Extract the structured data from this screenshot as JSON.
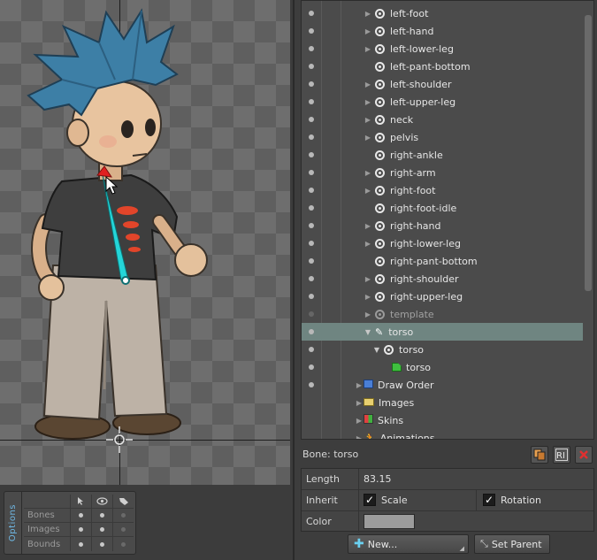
{
  "options": {
    "tab_label": "Options",
    "rows": [
      {
        "label": "Bones",
        "dots": [
          true,
          true,
          false
        ]
      },
      {
        "label": "Images",
        "dots": [
          true,
          true,
          false
        ]
      },
      {
        "label": "Bounds",
        "dots": [
          true,
          true,
          false
        ]
      }
    ],
    "column_icons": [
      "cursor-icon",
      "eye-icon",
      "tag-icon"
    ]
  },
  "tree": {
    "bones": [
      {
        "label": "left-foot",
        "arrow": true
      },
      {
        "label": "left-hand",
        "arrow": true
      },
      {
        "label": "left-lower-leg",
        "arrow": true
      },
      {
        "label": "left-pant-bottom",
        "arrow": false
      },
      {
        "label": "left-shoulder",
        "arrow": true
      },
      {
        "label": "left-upper-leg",
        "arrow": true
      },
      {
        "label": "neck",
        "arrow": true
      },
      {
        "label": "pelvis",
        "arrow": true
      },
      {
        "label": "right-ankle",
        "arrow": false
      },
      {
        "label": "right-arm",
        "arrow": true
      },
      {
        "label": "right-foot",
        "arrow": true
      },
      {
        "label": "right-foot-idle",
        "arrow": false
      },
      {
        "label": "right-hand",
        "arrow": true
      },
      {
        "label": "right-lower-leg",
        "arrow": true
      },
      {
        "label": "right-pant-bottom",
        "arrow": false
      },
      {
        "label": "right-shoulder",
        "arrow": true
      },
      {
        "label": "right-upper-leg",
        "arrow": true
      },
      {
        "label": "template",
        "arrow": true
      }
    ],
    "selected": "torso",
    "torso_slot": "torso",
    "torso_attachment": "torso",
    "sections": [
      {
        "label": "Draw Order",
        "icon": "draw-order-icon"
      },
      {
        "label": "Images",
        "icon": "folder-icon"
      },
      {
        "label": "Skins",
        "icon": "skins-icon"
      },
      {
        "label": "Animations",
        "icon": "animations-icon"
      }
    ]
  },
  "bone_panel": {
    "title": "Bone: torso",
    "length_label": "Length",
    "length_value": "83.15",
    "inherit_label": "Inherit",
    "scale_label": "Scale",
    "rotation_label": "Rotation",
    "color_label": "Color",
    "color_value": "#9c9c9c",
    "new_button": "New...",
    "set_parent_button": "Set Parent"
  }
}
